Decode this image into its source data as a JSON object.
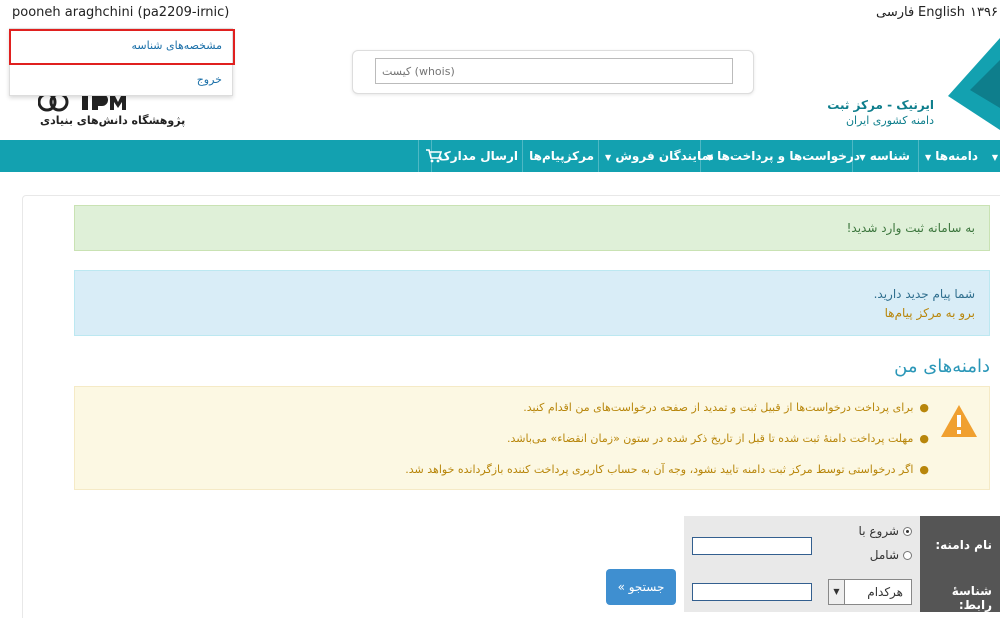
{
  "topbar": {
    "user": "pooneh araghchini (pa2209-irnic)",
    "lang_fa": "فارسی",
    "lang_en": "English",
    "year": "۱۳۹۶"
  },
  "dropdown": {
    "profile": "مشخصه‌های شناسه",
    "logout": "خروج"
  },
  "header": {
    "ipm_subtitle": "پژوهشگاه دانش‌های بنیادی",
    "search_placeholder": "کیست (whois)",
    "irnic_title": "ایرنیک - مرکز ثبت",
    "irnic_subtitle": "دامنه کشوری ایران"
  },
  "nav": {
    "items": [
      {
        "label": "دامنه‌ها"
      },
      {
        "label": "شناسه"
      },
      {
        "label": "درخواست‌ها و پرداخت‌ها"
      },
      {
        "label": "نمایندگان فروش"
      },
      {
        "label": "مرکزپیام‌ها"
      },
      {
        "label": "ارسال مدارک"
      }
    ]
  },
  "alerts": {
    "welcome": "به سامانه ثبت وارد شدید!",
    "new_message": "شما پیام جدید دارید.",
    "go_messages": "برو به مرکز پیام‌ها"
  },
  "section": {
    "title": "دامنه‌های من"
  },
  "warnings": [
    "برای پرداخت درخواست‌ها از قبیل ثبت و تمدید از صفحه درخواست‌های من اقدام کنید.",
    "مهلت پرداخت دامنهٔ ثبت شده تا قبل از تاریخ ذکر شده در ستون «زمان انقضاء» می‌باشد.",
    "اگر درخواستی توسط مرکز ثبت دامنه تایید نشود، وجه آن به حساب کاربری پرداخت کننده بازگردانده خواهد شد."
  ],
  "form": {
    "domain_label": "نام دامنه:",
    "contact_label": "شناسهٔ رابط:",
    "radio_starts": "شروع با",
    "radio_contains": "شامل",
    "select_value": "هرکدام",
    "search_button": "جستجو »"
  },
  "colors": {
    "nav_bg": "#13a1b0",
    "accent": "#2b97b8",
    "highlight": "#e0201f"
  }
}
